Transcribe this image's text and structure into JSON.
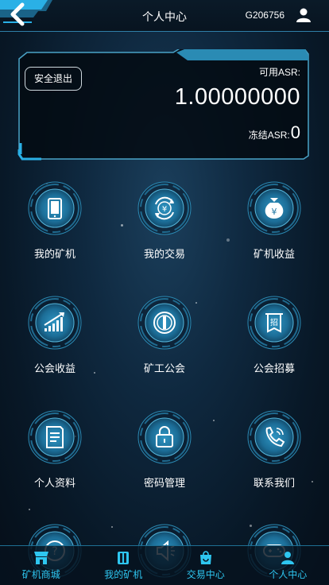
{
  "header": {
    "title": "个人中心",
    "user_id": "G206756"
  },
  "balance": {
    "logout_label": "安全退出",
    "available_label": "可用ASR:",
    "available_value": "1.00000000",
    "frozen_label": "冻结ASR:",
    "frozen_value": "0"
  },
  "grid": [
    {
      "label": "我的矿机",
      "icon": "phone-icon"
    },
    {
      "label": "我的交易",
      "icon": "yen-exchange-icon"
    },
    {
      "label": "矿机收益",
      "icon": "money-bag-icon"
    },
    {
      "label": "公会收益",
      "icon": "growth-chart-icon"
    },
    {
      "label": "矿工公会",
      "icon": "guild-emblem-icon"
    },
    {
      "label": "公会招募",
      "icon": "recruit-banner-icon"
    },
    {
      "label": "个人资料",
      "icon": "document-icon"
    },
    {
      "label": "密码管理",
      "icon": "lock-icon"
    },
    {
      "label": "联系我们",
      "icon": "phone-call-icon"
    },
    {
      "label": "",
      "icon": "help-icon"
    },
    {
      "label": "",
      "icon": "speaker-icon"
    },
    {
      "label": "",
      "icon": "gamepad-icon"
    }
  ],
  "nav": [
    {
      "label": "矿机商城",
      "icon": "store-icon"
    },
    {
      "label": "我的矿机",
      "icon": "machine-icon"
    },
    {
      "label": "交易中心",
      "icon": "bag-icon"
    },
    {
      "label": "个人中心",
      "icon": "user-icon"
    }
  ],
  "colors": {
    "accent": "#2ec6f0",
    "frame": "#4aa3c7",
    "icon_ring": "#2b8ab4"
  }
}
